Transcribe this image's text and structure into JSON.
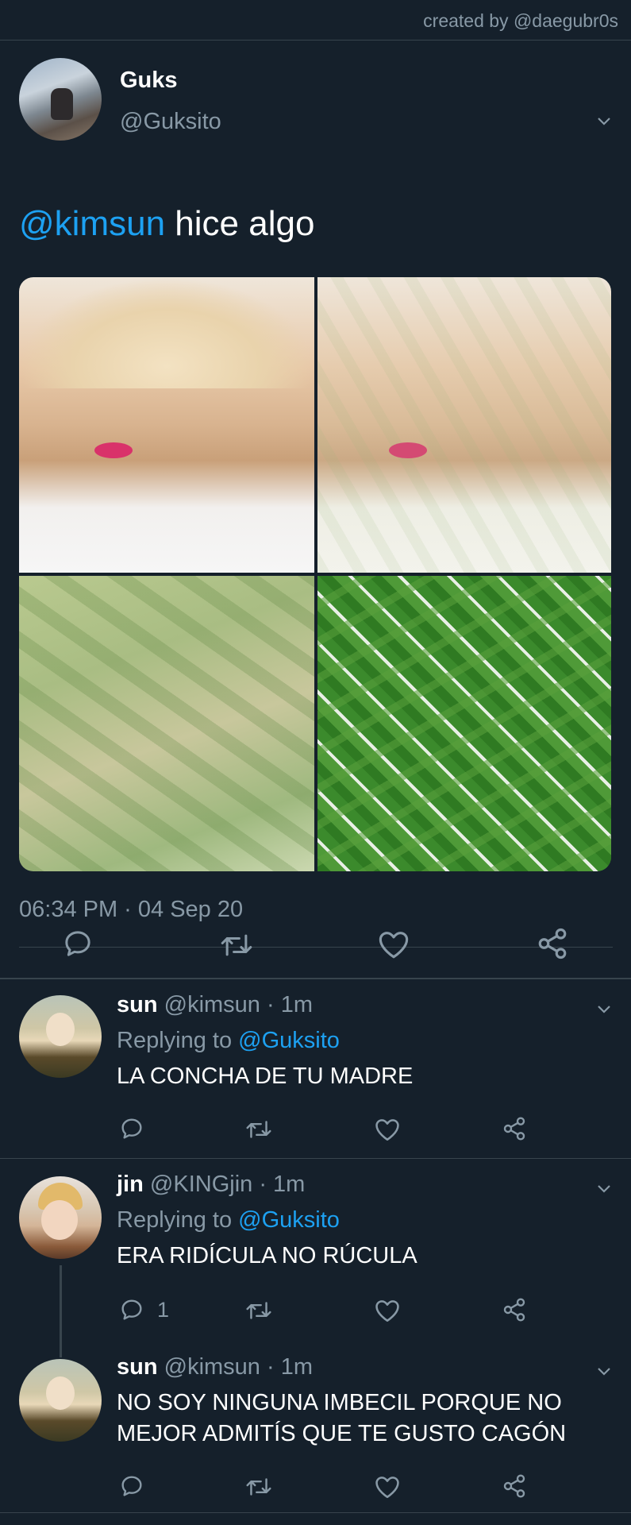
{
  "credit": "created by @daegubr0s",
  "tweet": {
    "display_name": "Guks",
    "handle": "@Guksito",
    "mention": "@kimsun",
    "text": "hice algo",
    "timestamp": "06:34 PM · 04 Sep 20"
  },
  "replies": [
    {
      "display_name": "sun",
      "handle": "@kimsun",
      "time": "· 1m",
      "replying_prefix": "Replying to",
      "replying_to": "@Guksito",
      "text": "LA CONCHA DE TU MADRE",
      "reply_count": ""
    },
    {
      "display_name": "jin",
      "handle": "@KINGjin",
      "time": "· 1m",
      "replying_prefix": "Replying to",
      "replying_to": "@Guksito",
      "text": "ERA RIDÍCULA NO RÚCULA",
      "reply_count": "1"
    },
    {
      "display_name": "sun",
      "handle": "@kimsun",
      "time": "· 1m",
      "text_line1": "NO SOY NINGUNA IMBECIL PORQUE NO",
      "text_line2": "MEJOR ADMITÍS QUE TE GUSTO CAGÓN"
    }
  ],
  "icons": [
    "chevron-down-icon",
    "reply-icon",
    "retweet-icon",
    "like-icon",
    "share-icon"
  ],
  "colors": {
    "background": "#15202b",
    "link": "#1da1f2",
    "muted": "#8899a6",
    "divider": "#38444d"
  }
}
